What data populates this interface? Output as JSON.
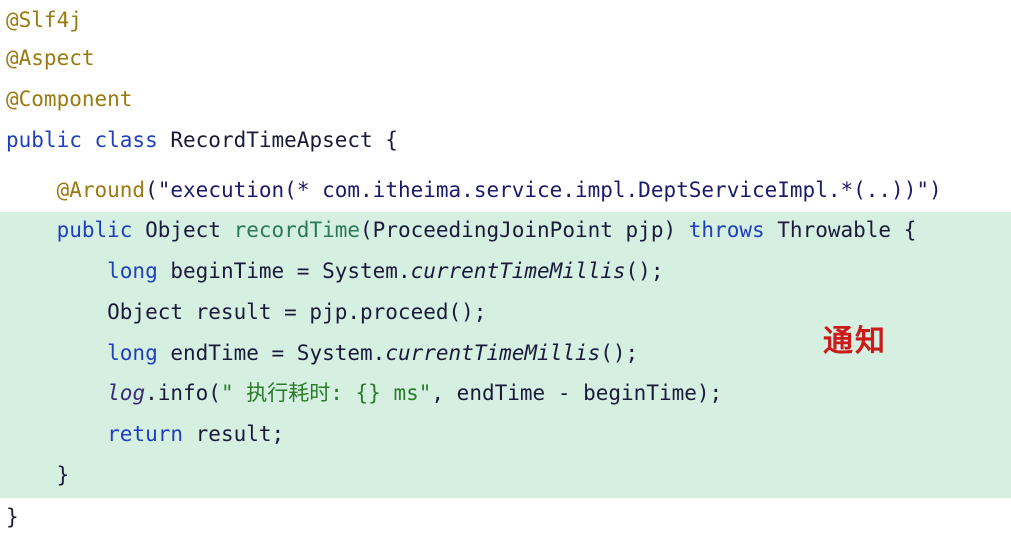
{
  "editor": {
    "highlight_color": "#d5efe1",
    "lines": [
      {
        "name": "annotation-slf4j",
        "segments": [
          {
            "t": "@Slf4j",
            "c": "#9a7a10"
          }
        ]
      },
      {
        "name": "annotation-aspect",
        "segments": [
          {
            "t": "@Aspect",
            "c": "#9a7a10"
          }
        ]
      },
      {
        "name": "annotation-component",
        "segments": [
          {
            "t": "@Component",
            "c": "#9a7a10"
          }
        ]
      },
      {
        "name": "class-declaration",
        "segments": [
          {
            "t": "public class ",
            "c": "#1f3fbf"
          },
          {
            "t": "RecordTimeApsect {",
            "c": "#1a1a3a"
          }
        ]
      },
      {
        "name": "around-annotation",
        "segments": [
          {
            "t": "    ",
            "c": "#1a1a3a"
          },
          {
            "t": "@Around",
            "c": "#9a7a10"
          },
          {
            "t": "(",
            "c": "#1a1a3a"
          },
          {
            "t": "\"execution(* com.itheima.service.impl.DeptServiceImpl.*(..))\")",
            "c": "#1b1b6b"
          }
        ]
      },
      {
        "name": "method-declaration",
        "segments": [
          {
            "t": "    public ",
            "c": "#1f3fbf"
          },
          {
            "t": "Object ",
            "c": "#1a1a3a"
          },
          {
            "t": "recordTime",
            "c": "#2a7a5a"
          },
          {
            "t": "(ProceedingJoinPoint pjp) ",
            "c": "#1a1a3a"
          },
          {
            "t": "throws ",
            "c": "#1f3fbf"
          },
          {
            "t": "Throwable {",
            "c": "#1a1a3a"
          }
        ]
      },
      {
        "name": "begin-time-line",
        "segments": [
          {
            "t": "        long ",
            "c": "#1f3fbf"
          },
          {
            "t": "beginTime = System.",
            "c": "#1a1a3a"
          },
          {
            "t": "currentTimeMillis",
            "c": "#1a1a3a",
            "i": true
          },
          {
            "t": "();",
            "c": "#1a1a3a"
          }
        ]
      },
      {
        "name": "proceed-line",
        "segments": [
          {
            "t": "        Object result = pjp.proceed();",
            "c": "#1a1a3a"
          }
        ]
      },
      {
        "name": "end-time-line",
        "segments": [
          {
            "t": "        long ",
            "c": "#1f3fbf"
          },
          {
            "t": "endTime = System.",
            "c": "#1a1a3a"
          },
          {
            "t": "currentTimeMillis",
            "c": "#1a1a3a",
            "i": true
          },
          {
            "t": "();",
            "c": "#1a1a3a"
          }
        ]
      },
      {
        "name": "log-line",
        "segments": [
          {
            "t": "        ",
            "c": "#1a1a3a"
          },
          {
            "t": "log",
            "c": "#3a2a7a",
            "i": true
          },
          {
            "t": ".info(",
            "c": "#1a1a3a"
          },
          {
            "t": "\" 执行耗时: {} ms\"",
            "c": "#2a7a2a"
          },
          {
            "t": ", endTime - beginTime);",
            "c": "#1a1a3a"
          }
        ]
      },
      {
        "name": "return-line",
        "segments": [
          {
            "t": "        return ",
            "c": "#1f3fbf"
          },
          {
            "t": "result;",
            "c": "#1a1a3a"
          }
        ]
      },
      {
        "name": "method-close-brace",
        "segments": [
          {
            "t": "    }",
            "c": "#1a1a3a"
          }
        ]
      },
      {
        "name": "class-close-brace",
        "segments": [
          {
            "t": "}",
            "c": "#1a1a3a"
          }
        ]
      }
    ]
  },
  "annotation": {
    "text": "通知",
    "color": "#cc1a1a"
  }
}
